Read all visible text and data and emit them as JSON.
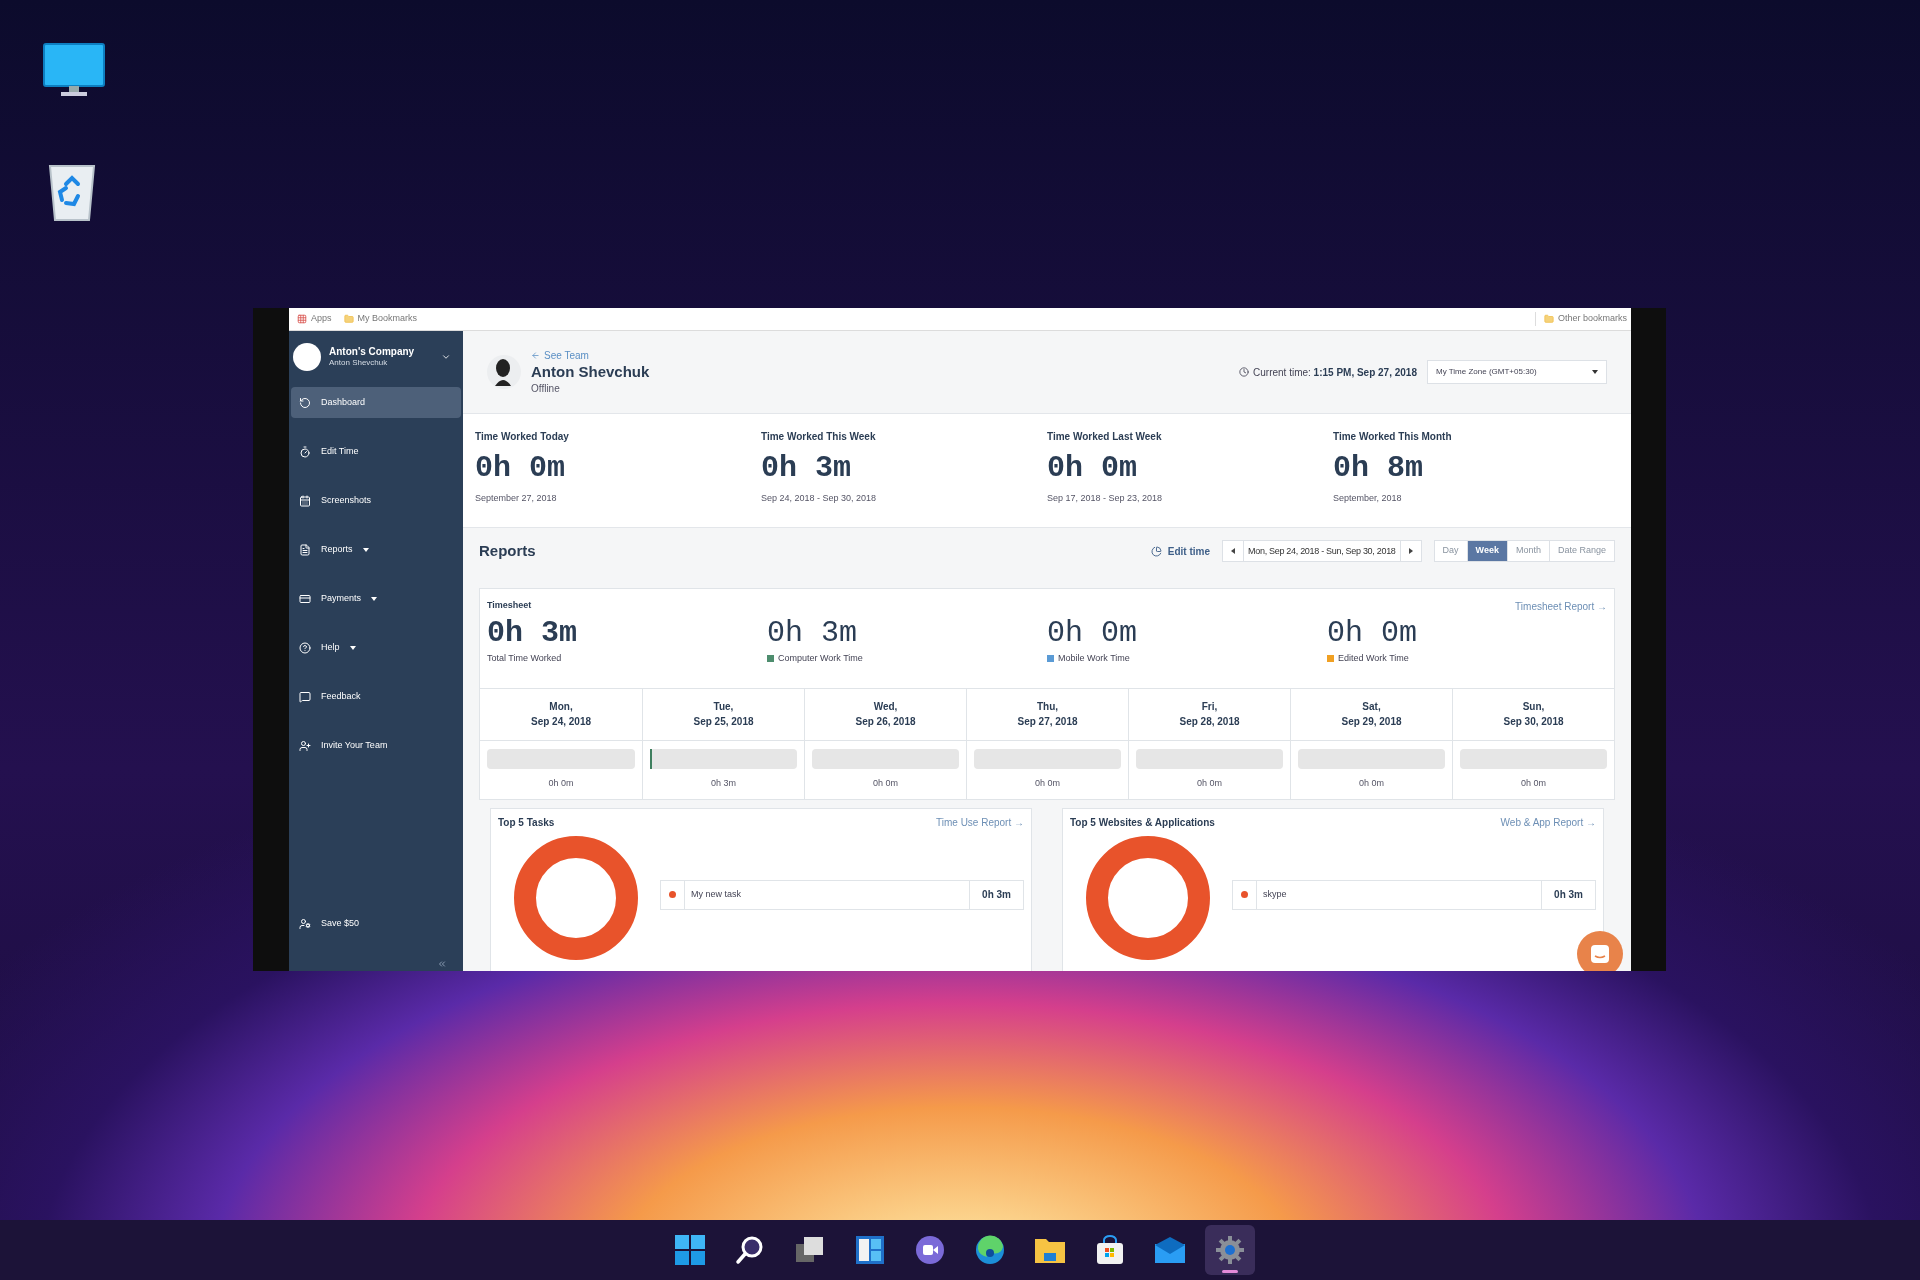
{
  "bookmarks_bar": {
    "items": [
      "Apps",
      "My Bookmarks"
    ],
    "right_item": "Other bookmarks"
  },
  "sidebar": {
    "company": "Anton's Company",
    "user": "Anton Shevchuk",
    "items": [
      {
        "kind": "dashboard",
        "label": "Dashboard",
        "selected": true,
        "has_menu": false
      },
      {
        "kind": "edit_time",
        "label": "Edit Time",
        "selected": false,
        "has_menu": false
      },
      {
        "kind": "screenshots",
        "label": "Screenshots",
        "selected": false,
        "has_menu": false
      },
      {
        "kind": "reports",
        "label": "Reports",
        "selected": false,
        "has_menu": true
      },
      {
        "kind": "payments",
        "label": "Payments",
        "selected": false,
        "has_menu": true
      },
      {
        "kind": "help",
        "label": "Help",
        "selected": false,
        "has_menu": true
      },
      {
        "kind": "feedback",
        "label": "Feedback",
        "selected": false,
        "has_menu": false
      },
      {
        "kind": "invite",
        "label": "Invite Your Team",
        "selected": false,
        "has_menu": false
      }
    ],
    "bottom_item": "Save $50"
  },
  "header": {
    "back_link": "See Team",
    "name": "Anton Shevchuk",
    "status": "Offline",
    "current_time_label": "Current time:",
    "current_time": "1:15 PM, Sep 27, 2018",
    "timezone": "My Time Zone (GMT+05:30)"
  },
  "stats": [
    {
      "title": "Time Worked Today",
      "value": "0h 0m",
      "range": "September 27, 2018"
    },
    {
      "title": "Time Worked This Week",
      "value": "0h 3m",
      "range": "Sep 24, 2018 - Sep 30, 2018"
    },
    {
      "title": "Time Worked Last Week",
      "value": "0h 0m",
      "range": "Sep 17, 2018 - Sep 23, 2018"
    },
    {
      "title": "Time Worked This Month",
      "value": "0h 8m",
      "range": "September, 2018"
    }
  ],
  "reports": {
    "title": "Reports",
    "edit_time": "Edit time",
    "date_range": "Mon, Sep 24, 2018 - Sun, Sep 30, 2018",
    "periods": [
      {
        "label": "Day",
        "selected": false
      },
      {
        "label": "Week",
        "selected": true
      },
      {
        "label": "Month",
        "selected": false
      },
      {
        "label": "Date Range",
        "selected": false
      }
    ]
  },
  "timesheet": {
    "title": "Timesheet",
    "link": "Timesheet Report →",
    "totals": [
      {
        "value": "0h 3m",
        "label": "Total Time Worked"
      },
      {
        "value": "0h 3m",
        "label": "Computer Work Time",
        "color": "#4e8d6e"
      },
      {
        "value": "0h 0m",
        "label": "Mobile Work Time",
        "color": "#5b9bd5"
      },
      {
        "value": "0h 0m",
        "label": "Edited Work Time",
        "color": "#f0a023"
      }
    ],
    "days": [
      {
        "day": "Mon,",
        "date": "Sep 24, 2018",
        "time": "0h 0m"
      },
      {
        "day": "Tue,",
        "date": "Sep 25, 2018",
        "level": 0.015,
        "time": "0h 3m"
      },
      {
        "day": "Wed,",
        "date": "Sep 26, 2018",
        "time": "0h 0m"
      },
      {
        "day": "Thu,",
        "date": "Sep 27, 2018",
        "time": "0h 0m"
      },
      {
        "day": "Fri,",
        "date": "Sep 28, 2018",
        "time": "0h 0m"
      },
      {
        "day": "Sat,",
        "date": "Sep 29, 2018",
        "time": "0h 0m"
      },
      {
        "day": "Sun,",
        "date": "Sep 30, 2018",
        "time": "0h 0m"
      }
    ]
  },
  "top_cards": [
    {
      "title": "Top 5 Tasks",
      "link": "Time Use Report →",
      "items": [
        {
          "name": "My new task",
          "time": "0h 3m",
          "color": "#e8532b"
        }
      ]
    },
    {
      "title": "Top 5 Websites & Applications",
      "link": "Web & App Report →",
      "items": [
        {
          "name": "skype",
          "time": "0h 3m",
          "color": "#e8532b"
        }
      ]
    }
  ],
  "taskbar": [
    {
      "kind": "start",
      "selected": false
    },
    {
      "kind": "search",
      "selected": false
    },
    {
      "kind": "task_view",
      "selected": false
    },
    {
      "kind": "widgets",
      "selected": false
    },
    {
      "kind": "chat",
      "selected": false
    },
    {
      "kind": "browser",
      "selected": false
    },
    {
      "kind": "files",
      "selected": false
    },
    {
      "kind": "store",
      "selected": false
    },
    {
      "kind": "mail",
      "selected": false
    },
    {
      "kind": "settings",
      "selected": true
    }
  ]
}
